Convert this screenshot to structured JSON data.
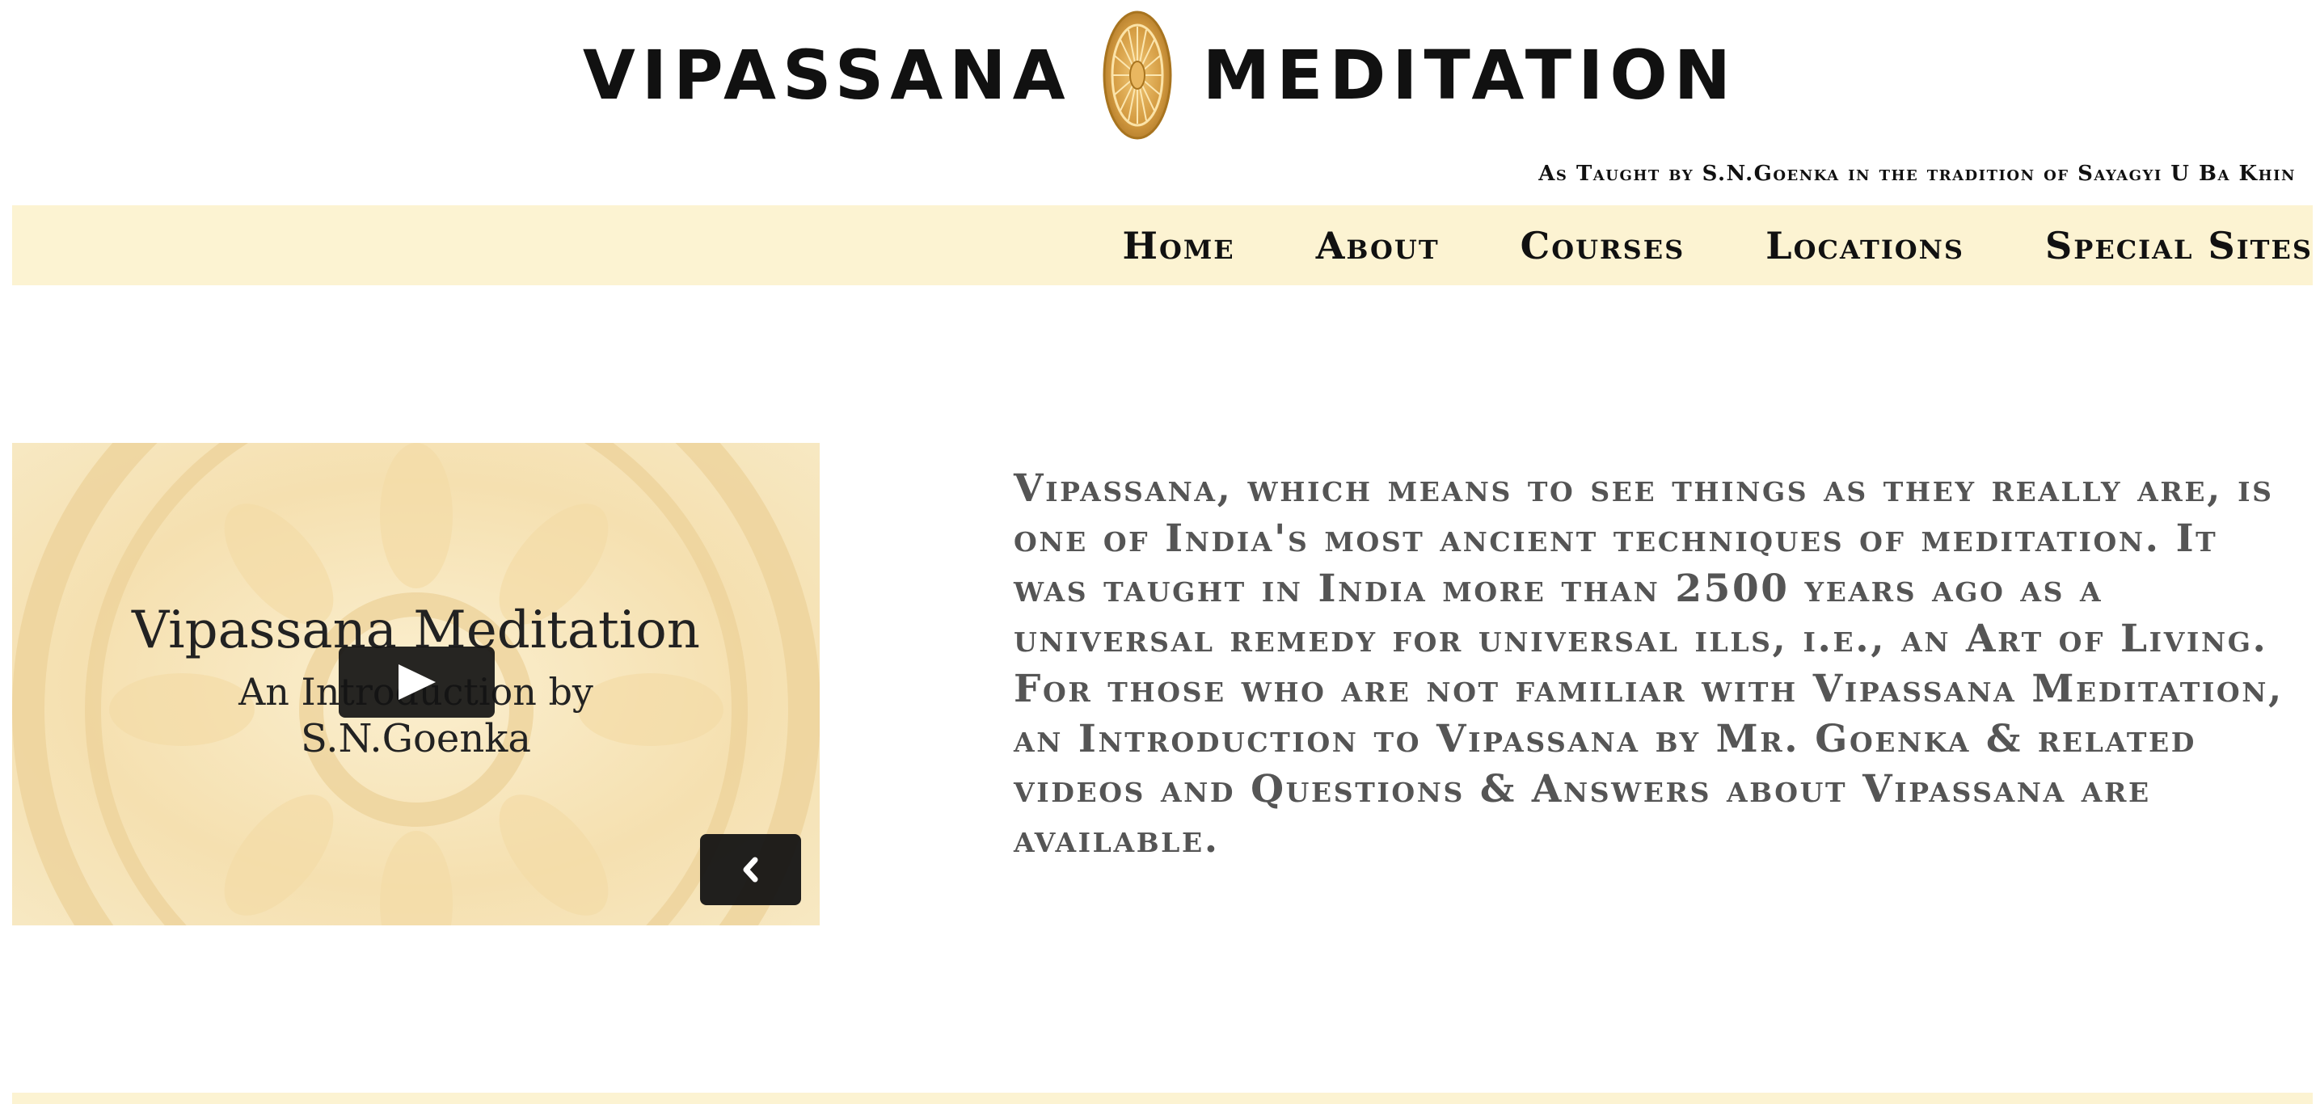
{
  "header": {
    "logo_left": "VIPASSANA",
    "logo_right": "MEDITATION",
    "logo_icon": "dhamma-wheel-icon",
    "tagline": "As Taught by S.N.Goenka in the tradition of Sayagyi U Ba Khin"
  },
  "nav": {
    "items": [
      {
        "label": "Home"
      },
      {
        "label": "About"
      },
      {
        "label": "Courses"
      },
      {
        "label": "Locations"
      },
      {
        "label": "Special Sites"
      }
    ]
  },
  "video": {
    "title": "Vipassana Meditation",
    "subtitle": "An Introduction by",
    "author": "S.N.Goenka",
    "play_icon": "play-icon",
    "prev_icon": "chevron-left-icon"
  },
  "intro": {
    "text": "Vipassana, which means to see things as they really are, is one of India's most ancient techniques of meditation. It was taught in India more than 2500 years ago as a universal remedy for universal ills, i.e., an Art of Living. For those who are not familiar with Vipassana Meditation, an Introduction to Vipassana by Mr. Goenka & related videos and Questions & Answers about Vipassana are available."
  },
  "colors": {
    "nav_background": "#fcf3d2",
    "text_dark": "#111111",
    "intro_text": "#555555",
    "wheel_gold": "#d9a24a"
  }
}
